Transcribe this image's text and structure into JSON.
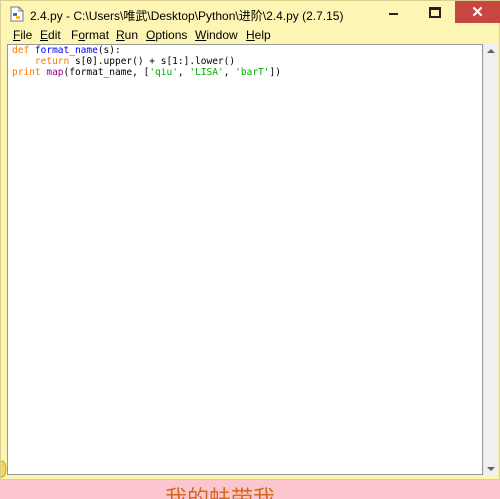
{
  "window": {
    "title": "2.4.py - C:\\Users\\唯武\\Desktop\\Python\\进阶\\2.4.py (2.7.15)",
    "controls": {
      "minimize": "minimize",
      "maximize": "maximize",
      "close": "✕"
    }
  },
  "menu": [
    {
      "mnemonic": "F",
      "rest": "ile"
    },
    {
      "mnemonic": "E",
      "rest": "dit"
    },
    {
      "mnemonic": "",
      "pre": "F",
      "mnemonic2": "o",
      "rest": "rmat"
    },
    {
      "mnemonic": "R",
      "rest": "un"
    },
    {
      "mnemonic": "O",
      "rest": "ptions"
    },
    {
      "mnemonic": "W",
      "rest": "indow"
    },
    {
      "mnemonic": "H",
      "rest": "elp"
    }
  ],
  "code": {
    "line1": {
      "kw": "def",
      "fn": "format_name",
      "rest": "(s):"
    },
    "line2": {
      "indent": "    ",
      "kw": "return",
      "rest": " s[0].upper() + s[1:].lower()"
    },
    "line3": {
      "kw": "print",
      "sp": " ",
      "bi": "map",
      "a": "(format_name, [",
      "s1": "'qiu'",
      "c1": ", ",
      "s2": "'LISA'",
      "c2": ", ",
      "s3": "'barT'",
      "z": "])"
    }
  },
  "colors": {
    "chrome_bg": "#fdf5b4",
    "close_button": "#c74640",
    "keyword": "#ff7700",
    "function_name": "#0000ff",
    "builtin": "#900090",
    "string": "#00aa00",
    "banner_bg": "#fcc6cf"
  },
  "banner": {
    "text": "我的蚨带我"
  }
}
